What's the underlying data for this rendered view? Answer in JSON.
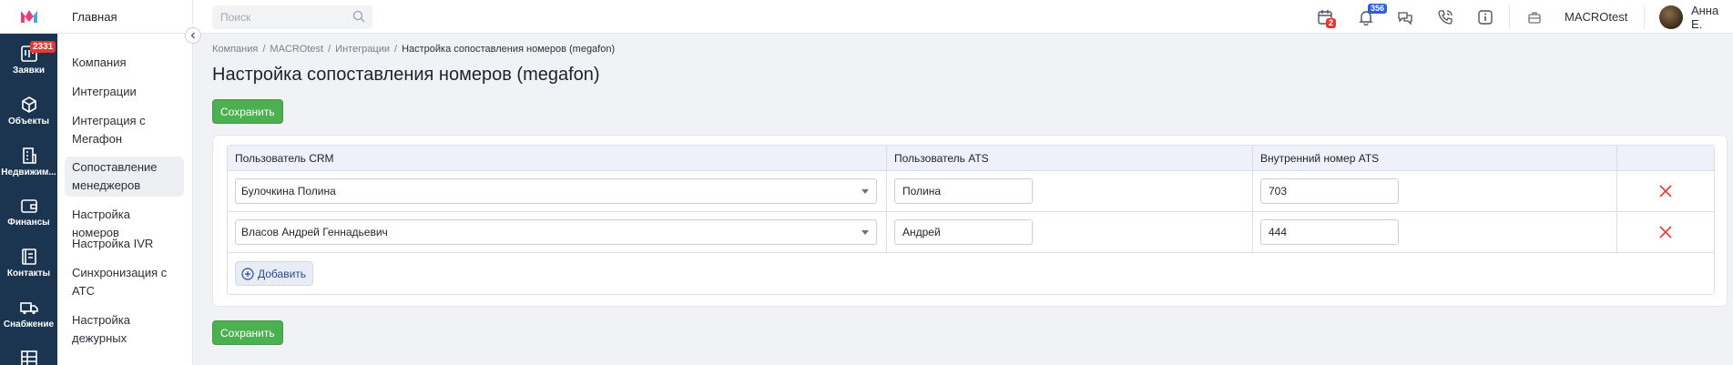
{
  "rail": {
    "items": [
      {
        "label": "Заявки",
        "badge": "2331"
      },
      {
        "label": "Объекты"
      },
      {
        "label": "Недвижим..."
      },
      {
        "label": "Финансы"
      },
      {
        "label": "Контакты"
      },
      {
        "label": "Снабжение"
      }
    ]
  },
  "sidebar": {
    "header": "Главная",
    "items": [
      {
        "label": "Компания"
      },
      {
        "label": "Интеграции"
      },
      {
        "label": "Интеграция с Мегафон"
      },
      {
        "label": "Сопоставление менеджеров",
        "active": true
      },
      {
        "label": "Настройка номеров"
      },
      {
        "label": "Настройка IVR"
      },
      {
        "label": "Синхронизация с АТС"
      },
      {
        "label": "Настройка дежурных"
      }
    ]
  },
  "topbar": {
    "search_placeholder": "Поиск",
    "calendar_badge": "2",
    "notifications_badge": "356",
    "company": "MACROtest",
    "user": "Анна Е."
  },
  "breadcrumb": [
    "Компания",
    "MACROtest",
    "Интеграции",
    "Настройка сопоставления номеров (megafon)"
  ],
  "page": {
    "title": "Настройка сопоставления номеров (megafon)",
    "save_label": "Сохранить",
    "add_label": "Добавить"
  },
  "table": {
    "columns": [
      "Пользователь CRM",
      "Пользователь ATS",
      "Внутренний номер ATS",
      ""
    ],
    "rows": [
      {
        "crm_user": "Булочкина Полина",
        "ats_user": "Полина",
        "ats_ext": "703"
      },
      {
        "crm_user": "Власов Андрей Геннадьевич",
        "ats_user": "Андрей",
        "ats_ext": "444"
      }
    ]
  },
  "colors": {
    "rail_bg": "#1b3551",
    "save_green": "#4caf50",
    "delete_red": "#e53935",
    "header_blue": "#eef1f9"
  }
}
